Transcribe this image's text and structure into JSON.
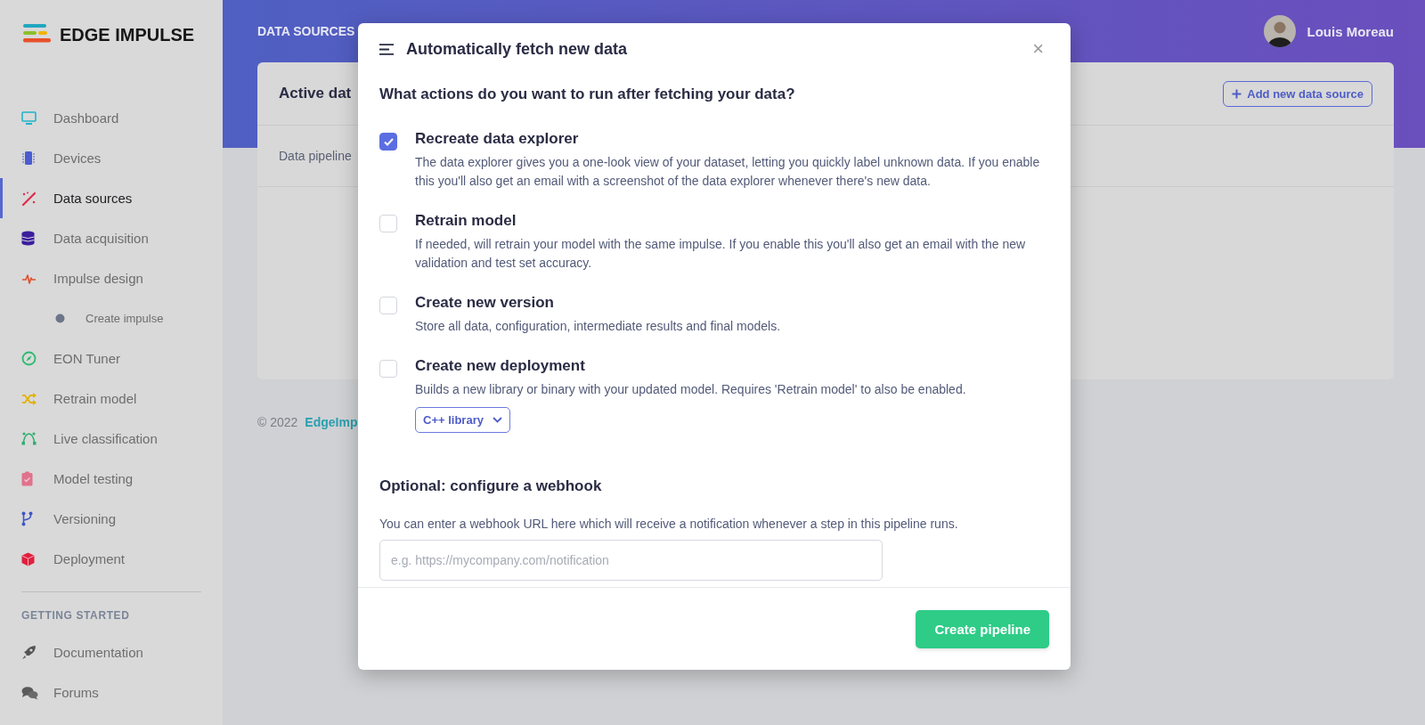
{
  "sidebar": {
    "logo": "EDGE IMPULSE",
    "items": [
      {
        "label": "Dashboard",
        "selected": false
      },
      {
        "label": "Devices",
        "selected": false
      },
      {
        "label": "Data sources",
        "selected": true
      },
      {
        "label": "Data acquisition",
        "selected": false
      },
      {
        "label": "Impulse design",
        "selected": false,
        "children": [
          {
            "label": "Create impulse",
            "selected": false
          }
        ]
      },
      {
        "label": "EON Tuner",
        "selected": false
      },
      {
        "label": "Retrain model",
        "selected": false
      },
      {
        "label": "Live classification",
        "selected": false
      },
      {
        "label": "Model testing",
        "selected": false
      },
      {
        "label": "Versioning",
        "selected": false
      },
      {
        "label": "Deployment",
        "selected": false
      }
    ],
    "section_title": "GETTING STARTED",
    "section_items": [
      {
        "label": "Documentation"
      },
      {
        "label": "Forums"
      }
    ]
  },
  "header": {
    "page_title": "DATA SOURCES",
    "user_name": "Louis Moreau"
  },
  "card": {
    "title": "Active dat",
    "add_button": "Add new data source",
    "row_label": "Data pipeline"
  },
  "footer": {
    "copyright": "© 2022",
    "link": "EdgeImp"
  },
  "modal": {
    "title": "Automatically fetch new data",
    "close": "×",
    "question": "What actions do you want to run after fetching your data?",
    "options": [
      {
        "title": "Recreate data explorer",
        "description": "The data explorer gives you a one-look view of your dataset, letting you quickly label unknown data. If you enable this you'll also get an email with a screenshot of the data explorer whenever there's new data.",
        "checked": true
      },
      {
        "title": "Retrain model",
        "description": "If needed, will retrain your model with the same impulse. If you enable this you'll also get an email with the new validation and test set accuracy.",
        "checked": false
      },
      {
        "title": "Create new version",
        "description": "Store all data, configuration, intermediate results and final models.",
        "checked": false
      },
      {
        "title": "Create new deployment",
        "description": "Builds a new library or binary with your updated model. Requires 'Retrain model' to also be enabled.",
        "checked": false,
        "dropdown": "C++ library"
      }
    ],
    "webhook_heading": "Optional: configure a webhook",
    "webhook_text": "You can enter a webhook URL here which will receive a notification whenever a step in this pipeline runs.",
    "webhook_field": {
      "placeholder": "e.g. https://mycompany.com/notification"
    },
    "submit_button": "Create pipeline"
  }
}
